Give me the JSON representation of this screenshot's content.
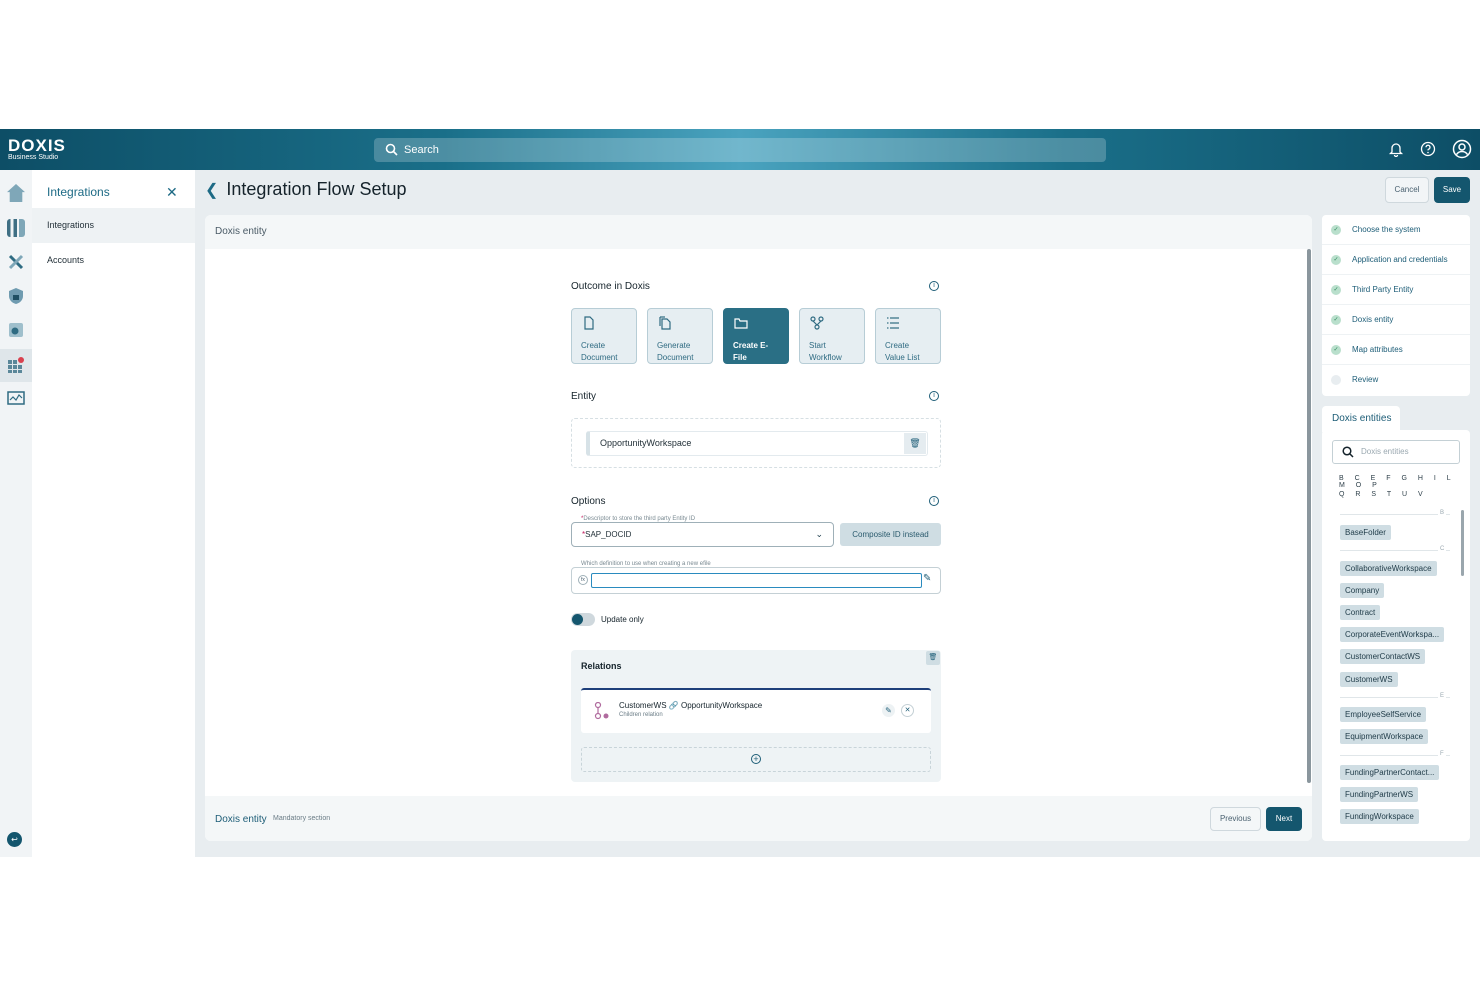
{
  "topbar": {
    "logo_main": "DOXIS",
    "logo_sub": "Business Studio",
    "search_placeholder": "Search"
  },
  "sidebar": {
    "title": "Integrations",
    "items": [
      {
        "label": "Integrations"
      },
      {
        "label": "Accounts"
      }
    ]
  },
  "page": {
    "title": "Integration Flow Setup",
    "cancel_label": "Cancel",
    "save_label": "Save"
  },
  "main": {
    "section_header": "Doxis entity",
    "outcome_label": "Outcome in Doxis",
    "outcome_cards": [
      {
        "line1": "Create",
        "line2": "Document"
      },
      {
        "line1": "Generate",
        "line2": "Document"
      },
      {
        "line1": "Create E-",
        "line2": "File"
      },
      {
        "line1": "Start",
        "line2": "Workflow"
      },
      {
        "line1": "Create",
        "line2": "Value List"
      }
    ],
    "entity_label": "Entity",
    "entity_value": "OpportunityWorkspace",
    "options_label": "Options",
    "descriptor_label": "Descriptor to store the third party Entity ID",
    "descriptor_value": "SAP_DOCID",
    "composite_label": "Composite ID instead",
    "definition_label": "Which definition to use when creating a new efile",
    "toggle_label": "Update only",
    "relations_label": "Relations",
    "relation": {
      "source": "CustomerWS",
      "target": "OpportunityWorkspace",
      "type": "Children relation"
    },
    "footer_title": "Doxis entity",
    "footer_note": "Mandatory section",
    "prev_label": "Previous",
    "next_label": "Next"
  },
  "steps": [
    {
      "label": "Choose the system",
      "done": true
    },
    {
      "label": "Application and credentials",
      "done": true
    },
    {
      "label": "Third Party Entity",
      "done": true
    },
    {
      "label": "Doxis entity",
      "done": true
    },
    {
      "label": "Map attributes",
      "done": true
    },
    {
      "label": "Review",
      "done": false
    }
  ],
  "entities": {
    "tab_label": "Doxis entities",
    "search_placeholder": "Doxis entities",
    "letters_row1": "B C E F G H I L M O P",
    "letters_row2": "Q R S T U V",
    "groups": [
      {
        "letter": "B",
        "items": [
          "BaseFolder"
        ]
      },
      {
        "letter": "C",
        "items": [
          "CollaborativeWorkspace",
          "Company",
          "Contract",
          "CorporateEventWorkspa...",
          "CustomerContactWS",
          "CustomerWS"
        ]
      },
      {
        "letter": "E",
        "items": [
          "EmployeeSelfService",
          "EquipmentWorkspace"
        ]
      },
      {
        "letter": "F",
        "items": [
          "FundingPartnerContact...",
          "FundingPartnerWS",
          "FundingWorkspace"
        ]
      }
    ]
  },
  "colors": {
    "primary": "#14566e",
    "accent": "#1d5d77",
    "header_gradient_mid": "#4aa3bf"
  }
}
